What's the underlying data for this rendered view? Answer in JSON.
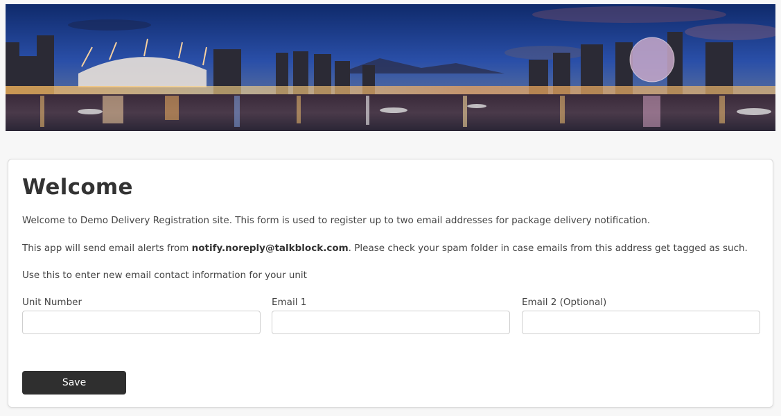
{
  "banner": {
    "image_name": "city-skyline-night-banner"
  },
  "card": {
    "title": "Welcome",
    "intro": "Welcome to Demo Delivery Registration site. This form is used to register up to two email addresses for package delivery notification.",
    "alerts_prefix": "This app will send email alerts from ",
    "alerts_email": "notify.noreply@talkblock.com",
    "alerts_suffix": ". Please check your spam folder in case emails from this address get tagged as such.",
    "instruction": "Use this to enter new email contact information for your unit"
  },
  "form": {
    "unit_label": "Unit Number",
    "unit_value": "",
    "email1_label": "Email 1",
    "email1_value": "",
    "email2_label": "Email 2 (Optional)",
    "email2_value": "",
    "save_label": "Save"
  },
  "colors": {
    "page_bg": "#f7f7f7",
    "button_bg": "#2f2f2f",
    "button_text": "#ffffff"
  }
}
